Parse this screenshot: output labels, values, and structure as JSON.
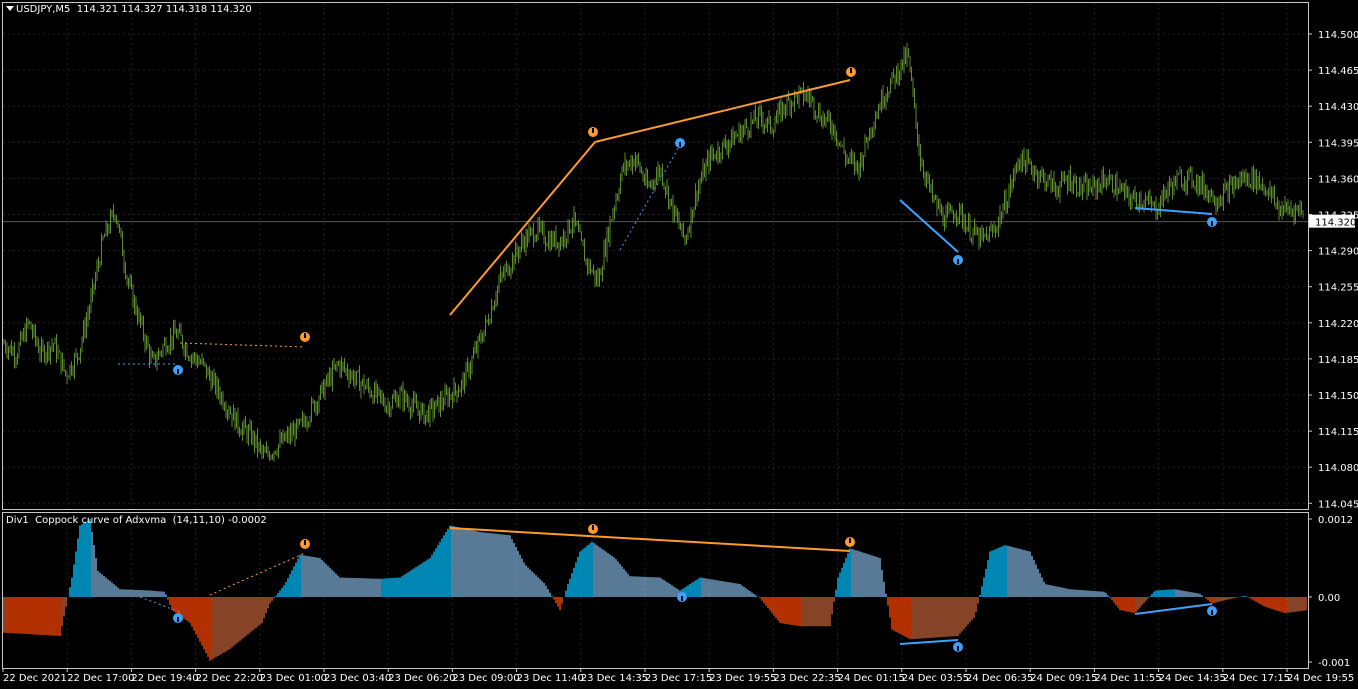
{
  "main_chart": {
    "symbol_label": "USDJPY,M5",
    "ohlc_label": "114.321 114.327 114.318 114.320",
    "current_price": "114.320",
    "price_ticks": [
      "114.500",
      "114.465",
      "114.430",
      "114.395",
      "114.360",
      "114.325",
      "114.290",
      "114.255",
      "114.220",
      "114.185",
      "114.150",
      "114.115",
      "114.080",
      "114.045"
    ],
    "price_range": [
      114.045,
      114.5
    ]
  },
  "indicator": {
    "label": "Div1",
    "name": "Coppock curve of Adxvma",
    "params": "(14,11,10)",
    "value": "-0.0002",
    "ticks": [
      "0.0012",
      "0.00",
      "-0.001"
    ]
  },
  "time_axis": {
    "labels": [
      "22 Dec 2021",
      "22 Dec 17:00",
      "22 Dec 19:40",
      "22 Dec 22:20",
      "23 Dec 01:00",
      "23 Dec 03:40",
      "23 Dec 06:20",
      "23 Dec 09:00",
      "23 Dec 11:40",
      "23 Dec 14:35",
      "23 Dec 17:15",
      "23 Dec 19:55",
      "23 Dec 22:35",
      "24 Dec 01:15",
      "24 Dec 03:55",
      "24 Dec 06:35",
      "24 Dec 09:15",
      "24 Dec 11:55",
      "24 Dec 14:35",
      "24 Dec 17:15",
      "24 Dec 19:55"
    ]
  },
  "colors": {
    "background": "#000000",
    "grid": "#2a1e1e",
    "candle": "#5b8c2e",
    "bull_histogram": "#00bfff",
    "bull_histogram_faded": "#7faed6",
    "bear_histogram": "#ff4500",
    "bear_histogram_faded": "#c0603a",
    "bearish_divergence": "#ff9a2e",
    "bullish_divergence": "#3da2ff"
  },
  "chart_data": {
    "type": "line",
    "series": [
      {
        "values": [
          114.2,
          114.19,
          114.22,
          114.19,
          114.2,
          114.17,
          114.19,
          114.24,
          114.3,
          114.33,
          114.26,
          114.22,
          114.18,
          114.2,
          114.21,
          114.19,
          114.18,
          114.16,
          114.14,
          114.12,
          114.11,
          114.09,
          114.1,
          114.11,
          114.12,
          114.14,
          114.16,
          114.18,
          114.17,
          114.16,
          114.15,
          114.14,
          114.15,
          114.14,
          114.13,
          114.14,
          114.15,
          114.16,
          114.19,
          114.22,
          114.26,
          114.28,
          114.3,
          114.31,
          114.3,
          114.3,
          114.32,
          114.28,
          114.26,
          114.32,
          114.37,
          114.38,
          114.35,
          114.37,
          114.33,
          114.3,
          114.35,
          114.38,
          114.39,
          114.4,
          114.41,
          114.42,
          114.41,
          114.43,
          114.44,
          114.44,
          114.42,
          114.41,
          114.38,
          114.37,
          114.41,
          114.44,
          114.46,
          114.48,
          114.38,
          114.34,
          114.32,
          114.33,
          114.31,
          114.3,
          114.31,
          114.34,
          114.38,
          114.37,
          114.36,
          114.35,
          114.36,
          114.35,
          114.35,
          114.36,
          114.35,
          114.34,
          114.34,
          114.33,
          114.35,
          114.36,
          114.36,
          114.35,
          114.34,
          114.35,
          114.36,
          114.36,
          114.35,
          114.33,
          114.33,
          114.33
        ]
      }
    ]
  }
}
